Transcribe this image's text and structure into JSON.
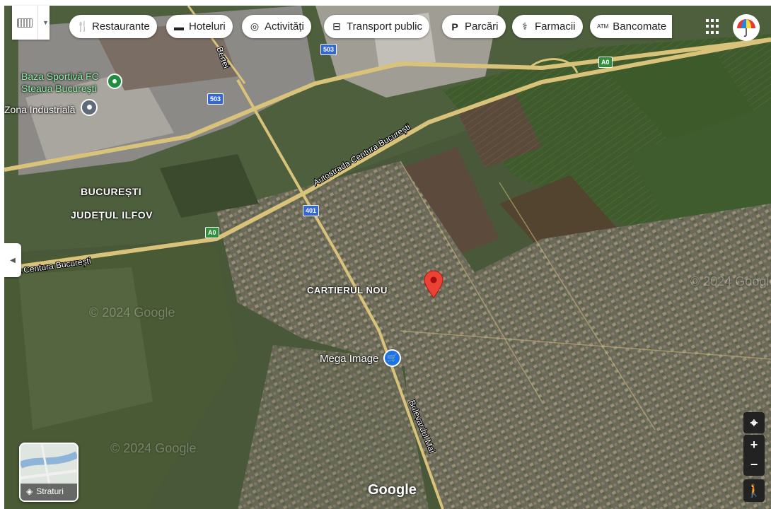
{
  "categories": [
    {
      "icon": "🍴",
      "label": "Restaurante",
      "name": "restaurants"
    },
    {
      "icon": "▬",
      "label": "Hoteluri",
      "name": "hotels"
    },
    {
      "icon": "◎",
      "label": "Activități",
      "name": "activities"
    },
    {
      "icon": "⊟",
      "label": "Transport public",
      "name": "transport"
    },
    {
      "icon": "P",
      "label": "Parcări",
      "name": "parking"
    },
    {
      "icon": "⚕",
      "label": "Farmacii",
      "name": "pharmacies"
    },
    {
      "icon": "ATM",
      "label": "Bancomate",
      "name": "atm"
    }
  ],
  "places": {
    "stadium_line1": "Baza Sportivă FC",
    "stadium_line2": "Steaua București",
    "industrial": "Zona Industrială",
    "bucuresti": "BUCUREȘTI",
    "ilfov": "JUDEȚUL ILFOV",
    "cartier": "CARTIERUL NOU",
    "mega": "Mega Image"
  },
  "roads": {
    "r503a": "503",
    "r503b": "503",
    "a0_top": "A0",
    "a0_mid": "A0",
    "r401": "401",
    "centura1": "Autostrada Centura București",
    "centura2": "ra Centura București",
    "bertei": "Bertei",
    "bulevard": "Bulevardul Mai"
  },
  "layers_label": "Straturi",
  "brand": "Google",
  "watermark": "© 2024 Google",
  "zoom_in": "+",
  "zoom_out": "−",
  "colors": {
    "pin": "#ea4335",
    "blue_poi": "#1a73e8",
    "green_poi": "#1e8e3e"
  }
}
